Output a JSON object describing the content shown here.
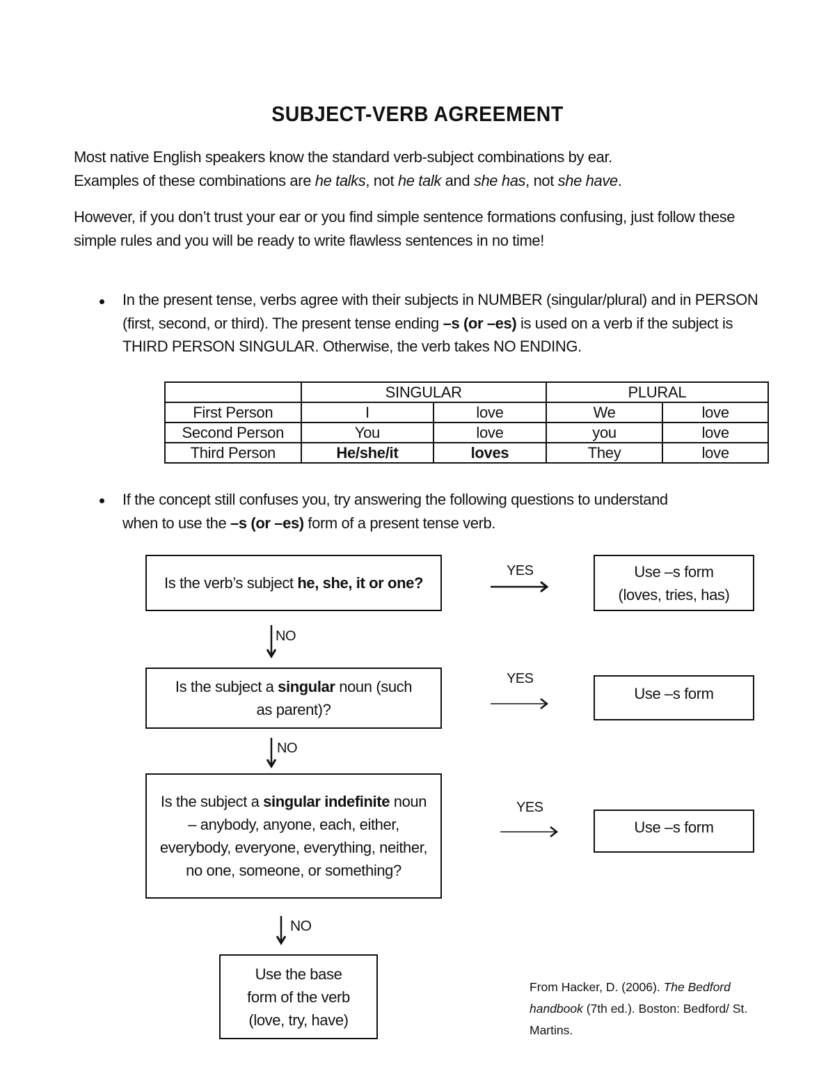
{
  "title": "SUBJECT-VERB AGREEMENT",
  "intro": {
    "p1_line1": "Most native English speakers know the standard verb-subject combinations by ear.",
    "p1_line2_prefix": "Examples of these combinations are ",
    "ex1": "he talks",
    "sep1": ", not ",
    "ex2": "he talk",
    "sep2": " and ",
    "ex3": "she has",
    "sep3": ", not ",
    "ex4": "she have",
    "end": ".",
    "p2": "However, if you don’t trust your ear or you find simple sentence formations confusing, just follow these simple rules and you will be ready to write flawless sentences in no time!"
  },
  "bullets": [
    {
      "pre": "In the present tense, verbs agree with their subjects in NUMBER (singular/plural) and in PERSON (first, second, or third). The present tense ending ",
      "bold": "–s (or –es)",
      "post": " is used on a verb if the subject is THIRD PERSON SINGULAR. Otherwise, the verb takes NO ENDING."
    },
    {
      "pre": "If the concept still confuses you, try answering the following questions to understand when to use the ",
      "bold": "–s (or –es)",
      "post": " form of a present tense verb."
    }
  ],
  "table": {
    "header": [
      "",
      "SINGULAR",
      "PLURAL"
    ],
    "rows": [
      {
        "person": "First Person",
        "sing_subj": "I",
        "sing_verb": "love",
        "plur_subj": "We",
        "plur_verb": "love"
      },
      {
        "person": "Second Person",
        "sing_subj": "You",
        "sing_verb": "love",
        "plur_subj": "you",
        "plur_verb": "love"
      },
      {
        "person": "Third Person",
        "sing_subj": "He/she/it",
        "sing_verb": "loves",
        "plur_subj": "They",
        "plur_verb": "love"
      }
    ]
  },
  "flowchart": {
    "q1": {
      "pre": "Is the verb’s subject ",
      "bold": "he, she, it or one?",
      "post": ""
    },
    "q2": {
      "pre": "Is the subject a ",
      "bold": "singular",
      "post": " noun (such as parent)?"
    },
    "q3": {
      "pre": "Is the subject a ",
      "bold": "singular indefinite",
      "post": " noun – anybody, anyone, each, either, everybody, everyone, everything, neither, no one, someone, or something?"
    },
    "a1_line1": "Use –s form",
    "a1_line2": "(loves, tries, has)",
    "a2": "Use –s form",
    "a3": "Use –s form",
    "final_line1": "Use the base",
    "final_line2": "form of the verb",
    "final_line3": "(love, try, have)",
    "yes_label": "YES",
    "no_label": "NO"
  },
  "citation": {
    "pre": "From Hacker, D. (2006). ",
    "italic1": "The Bedford handbook",
    "mid": " (7th ed.). Boston: Bedford/ St. Martins."
  }
}
